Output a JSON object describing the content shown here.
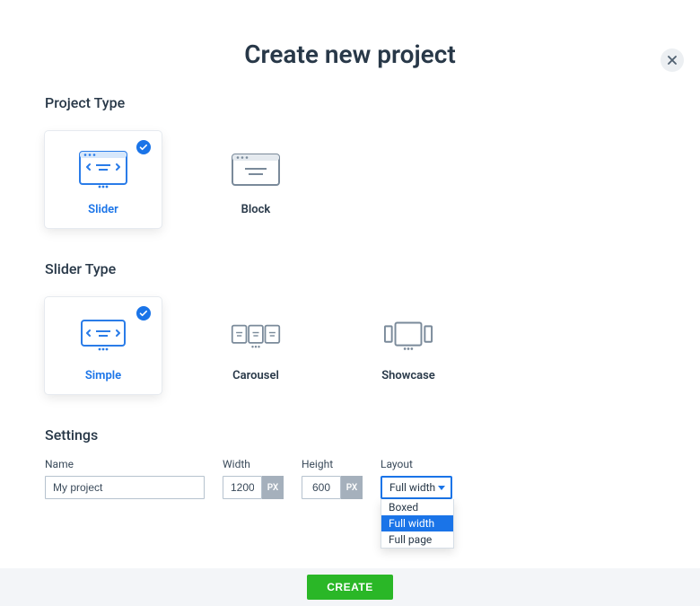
{
  "header": {
    "title": "Create new project"
  },
  "sections": {
    "projectType": {
      "title": "Project Type"
    },
    "sliderType": {
      "title": "Slider Type"
    },
    "settings": {
      "title": "Settings"
    }
  },
  "projectTypes": [
    {
      "label": "Slider",
      "selected": true
    },
    {
      "label": "Block",
      "selected": false
    }
  ],
  "sliderTypes": [
    {
      "label": "Simple",
      "selected": true
    },
    {
      "label": "Carousel",
      "selected": false
    },
    {
      "label": "Showcase",
      "selected": false
    }
  ],
  "settings": {
    "name": {
      "label": "Name",
      "value": "My project"
    },
    "width": {
      "label": "Width",
      "value": "1200",
      "unit": "PX"
    },
    "height": {
      "label": "Height",
      "value": "600",
      "unit": "PX"
    },
    "layout": {
      "label": "Layout",
      "value": "Full width",
      "options": [
        "Boxed",
        "Full width",
        "Full page"
      ]
    }
  },
  "footer": {
    "button": "CREATE"
  }
}
